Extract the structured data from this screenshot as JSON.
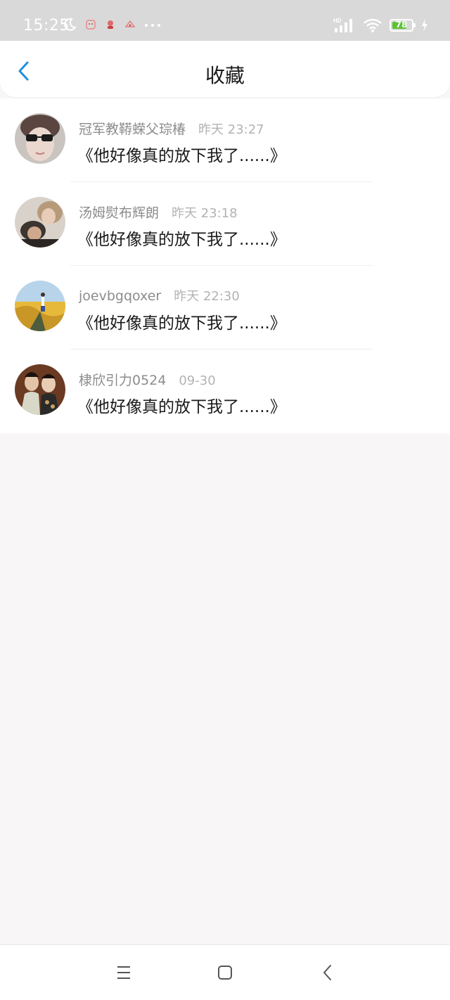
{
  "status_bar": {
    "time": "15:25",
    "icons_left": [
      "moon-icon",
      "app-notification-icon-1",
      "app-notification-icon-2",
      "app-notification-icon-3",
      "more-dots-icon"
    ],
    "icons_right": [
      "hd-signal-icon",
      "wifi-icon",
      "battery-icon",
      "charging-icon"
    ],
    "signal_label": "HD",
    "battery_level": "78",
    "battery_fraction": 0.78
  },
  "header": {
    "back_icon": "chevron-left-icon",
    "title": "收藏"
  },
  "favorites": [
    {
      "user": "冠军教鞯蝾父琮椿",
      "time": "昨天 23:27",
      "content": "《他好像真的放下我了......》",
      "avatar": "avatar-photo-sunglasses"
    },
    {
      "user": "汤姆熨布辉朗",
      "time": "昨天 23:18",
      "content": "《他好像真的放下我了......》",
      "avatar": "avatar-photo-couple"
    },
    {
      "user": "joevbgqoxer",
      "time": "昨天 22:30",
      "content": "《他好像真的放下我了......》",
      "avatar": "avatar-photo-flowers"
    },
    {
      "user": "棣欣引力0524",
      "time": "09-30",
      "content": "《他好像真的放下我了......》",
      "avatar": "avatar-photo-costume"
    }
  ],
  "nav_bar": {
    "icons": [
      "menu-icon",
      "home-icon",
      "back-icon"
    ]
  },
  "colors": {
    "accent": "#1e90e0",
    "status_bar": "#d9d9d9",
    "background": "#f9f6f7",
    "battery_green": "#5bc236"
  }
}
